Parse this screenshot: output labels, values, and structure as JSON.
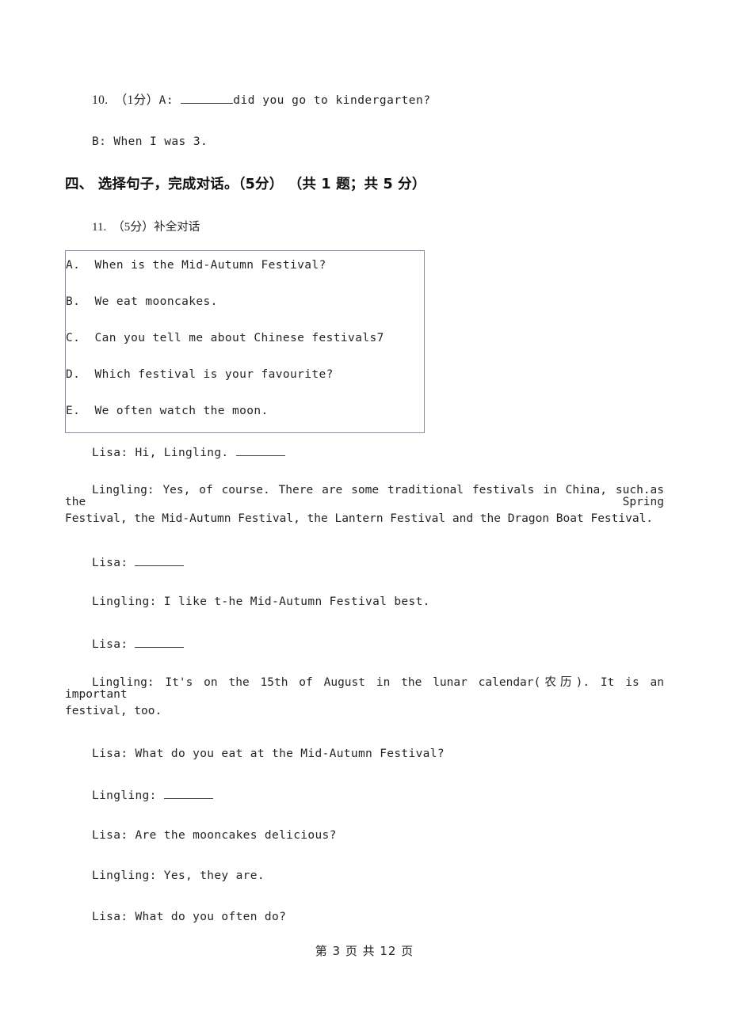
{
  "document": {
    "type": "exam-paper",
    "language": "zh-CN / en",
    "page_background": "#ffffff",
    "text_color": "#242424",
    "box_border_color": "#8f8f9c"
  },
  "question_10": {
    "number": "10.",
    "marks": "（1分）",
    "prompt_prefix": "A: ",
    "prompt_after_blank": "did you go to kindergarten?",
    "answer_line": "B: When I was 3."
  },
  "section_heading": "四、 选择句子，完成对话。（5分） （共 1 题；共 5 分）",
  "question_11": {
    "number": "11.",
    "marks": "（5分）",
    "title": "补全对话"
  },
  "options": [
    "A.  When is the Mid-Autumn Festival?",
    "B.  We eat mooncakes.",
    "C.  Can you tell me about Chinese festivals7",
    "D.  Which festival is your favourite?",
    "E.  We often watch the moon."
  ],
  "dialogue": {
    "l1": "Lisa: Hi, Lingling. ",
    "l2_first": "Lingling: Yes, of course. There are some traditional festivals in China, such.as the Spring",
    "l2_second": "Festival, the Mid-Autumn Festival, the Lantern Festival and the Dragon Boat Festival.",
    "l3": "Lisa: ",
    "l4": "Lingling: I like t-he Mid-Autumn Festival best.",
    "l5": "Lisa: ",
    "l6_first": "Lingling: It's on the 15th of August in the lunar calendar(农历). It is an important",
    "l6_second": "festival, too.",
    "l7": "Lisa: What do you eat at the Mid-Autumn Festival?",
    "l8": "Lingling: ",
    "l9": "Lisa: Are the mooncakes delicious?",
    "l10": "Lingling: Yes, they are.",
    "l11": "Lisa: What do you often do?"
  },
  "footer": {
    "text": "第 3 页 共 12 页",
    "current_page": "3",
    "total_pages": "12"
  }
}
